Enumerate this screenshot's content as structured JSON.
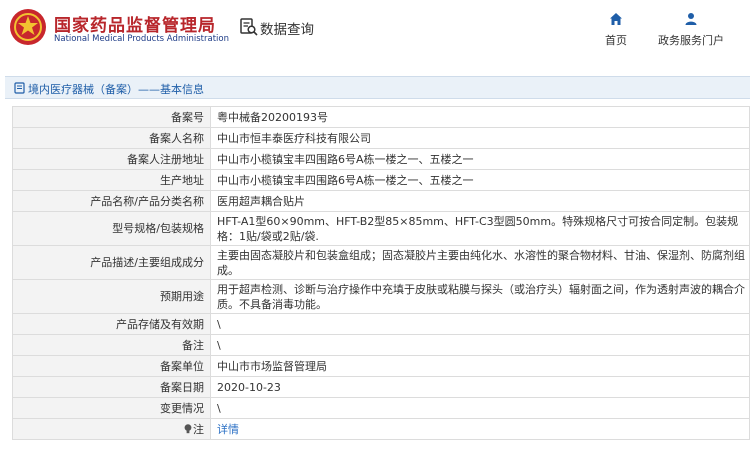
{
  "header": {
    "brand_cn": "国家药品监督管理局",
    "brand_en": "National Medical Products Administration",
    "db_query_label": "数据查询",
    "nav": {
      "home": "首页",
      "gov_services": "政务服务门户"
    },
    "colors": {
      "brand_red": "#b8262b",
      "brand_blue": "#1e3c87",
      "nav_blue": "#1f5ea8"
    }
  },
  "breadcrumb": {
    "text": "境内医疗器械（备案）——基本信息"
  },
  "record": {
    "rows": [
      {
        "key": "备案号",
        "value": "粤中械备20200193号"
      },
      {
        "key": "备案人名称",
        "value": "中山市恒丰泰医疗科技有限公司"
      },
      {
        "key": "备案人注册地址",
        "value": "中山市小榄镇宝丰四围路6号A栋一楼之一、五楼之一"
      },
      {
        "key": "生产地址",
        "value": "中山市小榄镇宝丰四围路6号A栋一楼之一、五楼之一"
      },
      {
        "key": "产品名称/产品分类名称",
        "value": "医用超声耦合贴片"
      },
      {
        "key": "型号规格/包装规格",
        "value": "HFT-A1型60×90mm、HFT-B2型85×85mm、HFT-C3型圆50mm。特殊规格尺寸可按合同定制。包装规格：1贴/袋或2贴/袋."
      },
      {
        "key": "产品描述/主要组成成分",
        "value": "主要由固态凝胶片和包装盒组成；固态凝胶片主要由纯化水、水溶性的聚合物材料、甘油、保湿剂、防腐剂组成。"
      },
      {
        "key": "预期用途",
        "value": "用于超声检测、诊断与治疗操作中充填于皮肤或粘膜与探头（或治疗头）辐射面之间，作为透射声波的耦合介质。不具备消毒功能。"
      },
      {
        "key": "产品存储及有效期",
        "value": "\\"
      },
      {
        "key": "备注",
        "value": "\\"
      },
      {
        "key": "备案单位",
        "value": "中山市市场监督管理局"
      },
      {
        "key": "备案日期",
        "value": "2020-10-23"
      },
      {
        "key": "变更情况",
        "value": "\\"
      }
    ],
    "note_row": {
      "key": "注",
      "link": "详情"
    }
  }
}
